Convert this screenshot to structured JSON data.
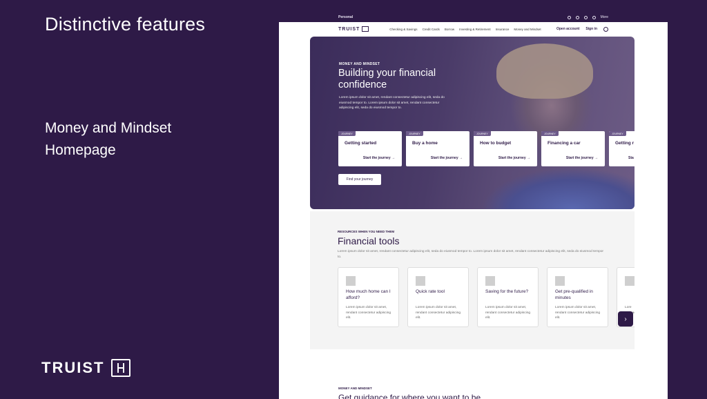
{
  "slide": {
    "title": "Distinctive features",
    "subtitle": "Money and Mindset Homepage",
    "brand": "TRUIST"
  },
  "utility": {
    "segment": "Personal",
    "more": "More"
  },
  "nav": {
    "logo": "TRUIST",
    "links": [
      "Checking & Savings",
      "Credit Cards",
      "Borrow",
      "Investing & Retirement",
      "Insurance",
      "Money and Mindset"
    ],
    "open_account": "Open account",
    "sign_in": "Sign in"
  },
  "hero": {
    "eyebrow": "MONEY AND MINDSET",
    "title": "Building your financial confidence",
    "body": "Lorem ipsum dolor sit amet, rendant consectetur adipiscing elit, seda do eiusmod tempor to. Lorem ipsum dolor sit amet, rendant consectetur adipiscing elit, seda do eiusmod tempor to.",
    "cards": [
      {
        "tag": "JOURNEY",
        "title": "Getting started",
        "cta": "Start the journey →"
      },
      {
        "tag": "JOURNEY",
        "title": "Buy a home",
        "cta": "Start the journey →"
      },
      {
        "tag": "JOURNEY",
        "title": "How to budget",
        "cta": "Start the journey →"
      },
      {
        "tag": "JOURNEY",
        "title": "Financing a car",
        "cta": "Start the journey →"
      },
      {
        "tag": "JOURNEY",
        "title": "Getting r",
        "cta": "Sta"
      }
    ],
    "find_button": "Find your journey"
  },
  "tools": {
    "eyebrow": "RESOURCES WHEN YOU NEED THEM",
    "title": "Financial tools",
    "body": "Lorem ipsum dolor sit amet, rendant consectetur adipiscing elit, seda do eiusmod tempor to. Lorem ipsum dolor sit amet, rendant consectetur adipiscing elit, seda do eiusmod tempor to.",
    "cards": [
      {
        "title": "How much home can I afford?",
        "desc": "Lorem ipsum dolor sit amet, rendant consectetur adipiscing elit."
      },
      {
        "title": "Quick rate tool",
        "desc": "Lorem ipsum dolor sit amet, rendant consectetur adipiscing elit."
      },
      {
        "title": "Saving for the future?",
        "desc": "Lorem ipsum dolor sit amet, rendant consectetur adipiscing elit."
      },
      {
        "title": "Get pre-qualified in minutes",
        "desc": "Lorem ipsum dolor sit amet, rendant consectetur adipiscing elit."
      },
      {
        "title": "",
        "desc": "Lore ame adip"
      }
    ],
    "next_icon": "chevron-right-icon"
  },
  "bottom": {
    "eyebrow": "MONEY AND MINDSET",
    "title": "Get guidance for where you want to be"
  }
}
